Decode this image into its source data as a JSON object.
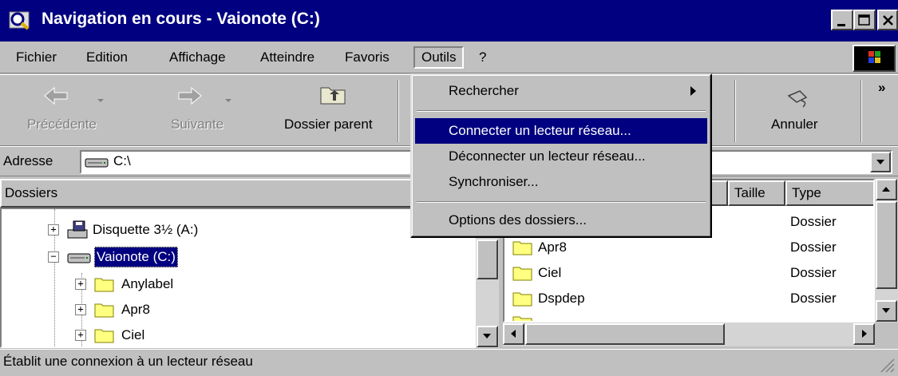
{
  "window": {
    "title": "Navigation en cours - Vaionote (C:)"
  },
  "menubar": {
    "items": [
      "Fichier",
      "Edition",
      "Affichage",
      "Atteindre",
      "Favoris",
      "Outils",
      "?"
    ]
  },
  "toolbar": {
    "back_label": "Précédente",
    "forward_label": "Suivante",
    "parent_label": "Dossier parent",
    "undo_label": "Annuler",
    "more_label": "»"
  },
  "address": {
    "label": "Adresse",
    "value": "C:\\"
  },
  "left_panel": {
    "header": "Dossiers",
    "tree": [
      {
        "label": "Disquette 3½ (A:)",
        "icon": "floppy-drive-icon"
      },
      {
        "label": "Vaionote (C:)",
        "icon": "hard-drive-icon",
        "selected": true
      },
      {
        "label": "Anylabel",
        "icon": "folder-icon"
      },
      {
        "label": "Apr8",
        "icon": "folder-icon"
      },
      {
        "label": "Ciel",
        "icon": "folder-icon"
      }
    ]
  },
  "right_panel": {
    "columns": [
      "Taille",
      "Type"
    ],
    "rows": [
      {
        "name": "",
        "type": "Dossier"
      },
      {
        "name": "Apr8",
        "type": "Dossier"
      },
      {
        "name": "Ciel",
        "type": "Dossier"
      },
      {
        "name": "Dspdep",
        "type": "Dossier"
      },
      {
        "name": "",
        "type": ""
      }
    ]
  },
  "outils_menu": {
    "items": [
      {
        "label": "Rechercher",
        "submenu": true
      },
      {
        "label": "Connecter un lecteur réseau...",
        "highlighted": true
      },
      {
        "label": "Déconnecter un lecteur réseau..."
      },
      {
        "label": "Synchroniser..."
      },
      {
        "label": "Options des dossiers..."
      }
    ]
  },
  "statusbar": {
    "text": "Établit une connexion à un lecteur réseau"
  },
  "colors": {
    "titlebar": "#000080",
    "highlight": "#000080",
    "face": "#c0c0c0"
  }
}
